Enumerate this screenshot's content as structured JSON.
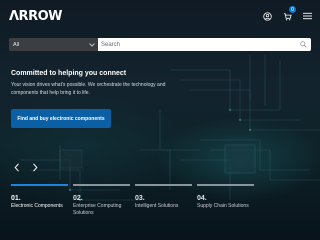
{
  "header": {
    "logo": "ΛRROW",
    "cart_count": "0"
  },
  "search": {
    "category": "All",
    "placeholder": "Search"
  },
  "hero": {
    "title": "Committed to helping you connect",
    "body": "Your vision drives what's possible. We orchestrate the technology and components that help bring it to life.",
    "cta_label": "Find and buy electronic components"
  },
  "carousel": {
    "prev_label": "‹",
    "next_label": "›",
    "tabs": [
      {
        "num": "01.",
        "label": "Electronic Components"
      },
      {
        "num": "02.",
        "label": "Enterprise Computing Solutions"
      },
      {
        "num": "03.",
        "label": "Intelligent Solutions"
      },
      {
        "num": "04.",
        "label": "Supply Chain Solutions"
      }
    ]
  },
  "colors": {
    "accent": "#1d84dd",
    "cta": "#0b5fa5"
  }
}
